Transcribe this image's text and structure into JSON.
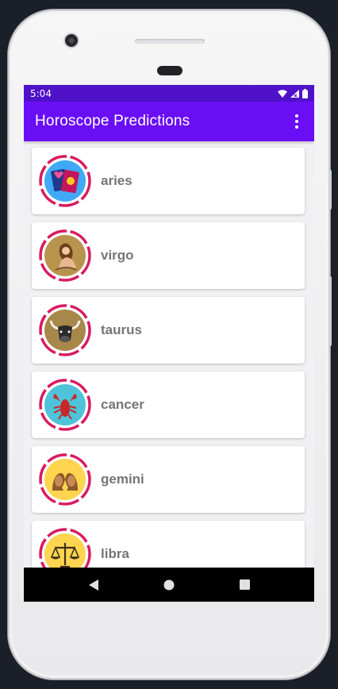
{
  "status_bar": {
    "time": "5:04",
    "icons": [
      "wifi-icon",
      "signal-icon",
      "battery-icon"
    ]
  },
  "app_bar": {
    "title": "Horoscope Predictions",
    "menu_icon": "more-vert-icon"
  },
  "signs": [
    {
      "label": "aries",
      "icon": "tarot-cards-icon"
    },
    {
      "label": "virgo",
      "icon": "maiden-icon"
    },
    {
      "label": "taurus",
      "icon": "bull-icon"
    },
    {
      "label": "cancer",
      "icon": "crab-icon"
    },
    {
      "label": "gemini",
      "icon": "twins-icon"
    },
    {
      "label": "libra",
      "icon": "scales-icon"
    }
  ],
  "nav": {
    "icons": [
      "back-icon",
      "home-icon",
      "recents-icon"
    ]
  },
  "colors": {
    "status_bar": "#4f12c9",
    "app_bar": "#6a0ef5",
    "ring": "#d81b60",
    "label": "#757575"
  }
}
